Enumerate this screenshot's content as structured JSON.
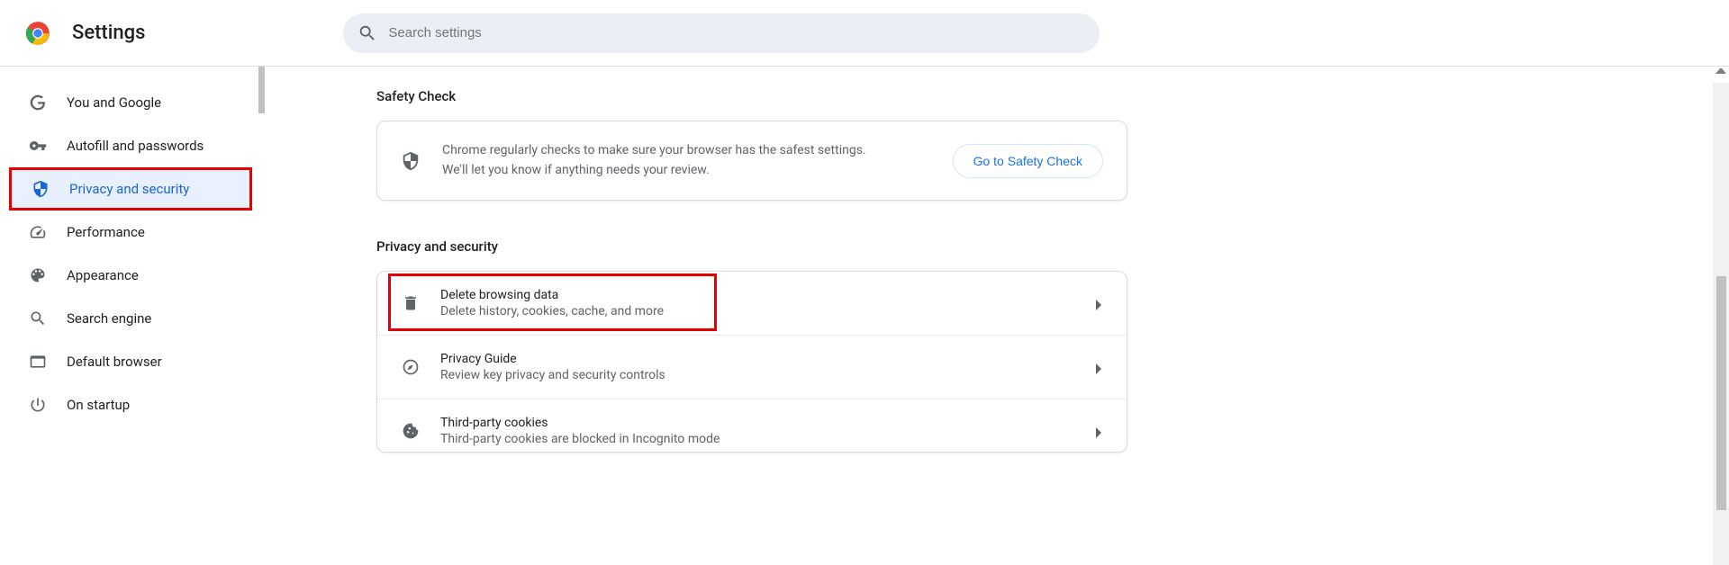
{
  "header": {
    "title": "Settings",
    "search_placeholder": "Search settings"
  },
  "sidebar": {
    "items": [
      {
        "label": "You and Google"
      },
      {
        "label": "Autofill and passwords"
      },
      {
        "label": "Privacy and security"
      },
      {
        "label": "Performance"
      },
      {
        "label": "Appearance"
      },
      {
        "label": "Search engine"
      },
      {
        "label": "Default browser"
      },
      {
        "label": "On startup"
      }
    ]
  },
  "main": {
    "safety_check": {
      "title": "Safety Check",
      "line1": "Chrome regularly checks to make sure your browser has the safest settings.",
      "line2": "We'll let you know if anything needs your review.",
      "button": "Go to Safety Check"
    },
    "privacy": {
      "title": "Privacy and security",
      "rows": [
        {
          "title": "Delete browsing data",
          "sub": "Delete history, cookies, cache, and more"
        },
        {
          "title": "Privacy Guide",
          "sub": "Review key privacy and security controls"
        },
        {
          "title": "Third-party cookies",
          "sub": "Third-party cookies are blocked in Incognito mode"
        }
      ]
    }
  }
}
